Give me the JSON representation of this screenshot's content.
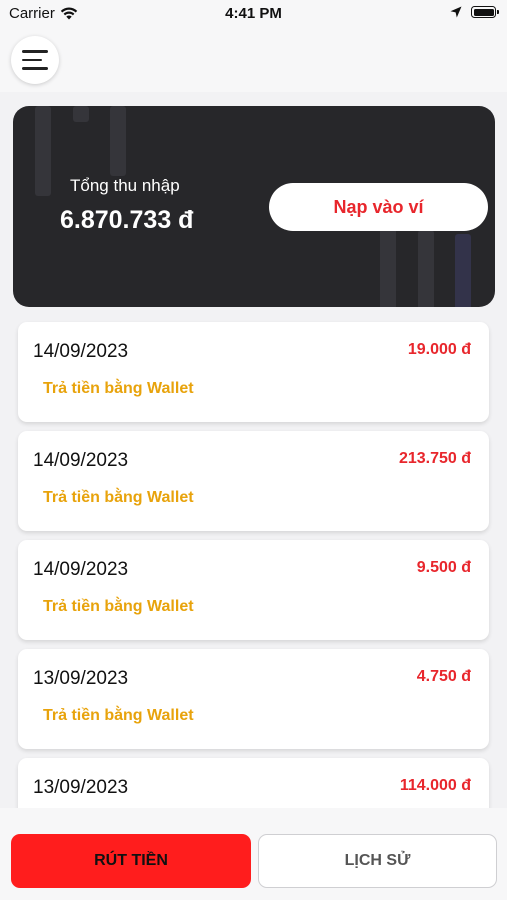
{
  "status_bar": {
    "carrier": "Carrier",
    "time": "4:41 PM"
  },
  "header": {
    "menu_icon": "hamburger-menu-icon"
  },
  "balance_card": {
    "label": "Tổng thu nhập",
    "amount": "6.870.733 đ",
    "deposit_label": "Nạp vào ví"
  },
  "transactions": [
    {
      "date": "14/09/2023",
      "amount": "19.000 đ",
      "description": "Trả tiền bằng Wallet"
    },
    {
      "date": "14/09/2023",
      "amount": "213.750 đ",
      "description": "Trả tiền bằng Wallet"
    },
    {
      "date": "14/09/2023",
      "amount": "9.500 đ",
      "description": "Trả tiền bằng Wallet"
    },
    {
      "date": "13/09/2023",
      "amount": "4.750 đ",
      "description": "Trả tiền bằng Wallet"
    },
    {
      "date": "13/09/2023",
      "amount": "114.000 đ",
      "description": ""
    }
  ],
  "actions": {
    "withdraw_label": "RÚT TIỀN",
    "history_label": "LỊCH SỬ"
  },
  "colors": {
    "accent_red": "#e8262c",
    "withdraw_red": "#ff1d1d",
    "description_orange": "#e8a30c",
    "card_dark": "#27272a"
  }
}
